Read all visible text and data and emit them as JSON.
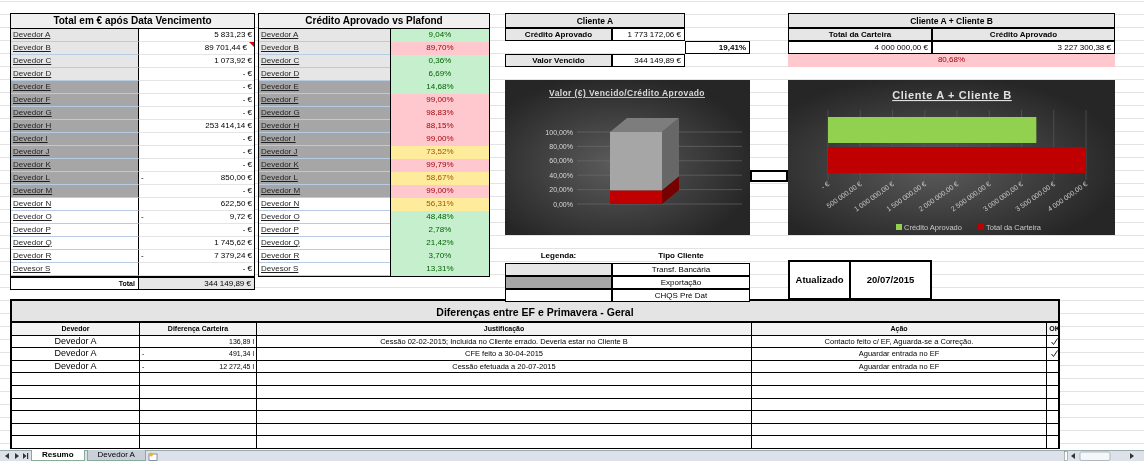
{
  "overdue_table": {
    "title": "Total em € após Data Vencimento",
    "rows": [
      {
        "name": "Devedor A",
        "color": "#e7e6e6",
        "value": "5 831,23 €",
        "commented": false
      },
      {
        "name": "Devedor B",
        "color": "#e7e6e6",
        "value": "89 701,44 €",
        "commented": true
      },
      {
        "name": "Devedor C",
        "color": "#e7e6e6",
        "value": "1 073,92 €",
        "commented": false
      },
      {
        "name": "Devedor D",
        "color": "#e7e6e6",
        "value": "- €",
        "commented": false
      },
      {
        "name": "Devedor E",
        "color": "#a6a6a6",
        "value": "- €",
        "commented": false
      },
      {
        "name": "Devedor F",
        "color": "#a6a6a6",
        "value": "- €",
        "commented": false
      },
      {
        "name": "Devedor G",
        "color": "#a6a6a6",
        "value": "- €",
        "commented": false
      },
      {
        "name": "Devedor H",
        "color": "#a6a6a6",
        "value": "253 414,14 €",
        "commented": false
      },
      {
        "name": "Devedor I",
        "color": "#a6a6a6",
        "value": "- €",
        "commented": false
      },
      {
        "name": "Devedor J",
        "color": "#a6a6a6",
        "value": "- €",
        "commented": false
      },
      {
        "name": "Devedor K",
        "color": "#a6a6a6",
        "value": "- €",
        "commented": false
      },
      {
        "name": "Devedor L",
        "color": "#a6a6a6",
        "sign": "-",
        "value": "850,00 €",
        "commented": false
      },
      {
        "name": "Devedor M",
        "color": "#a6a6a6",
        "value": "- €",
        "commented": false
      },
      {
        "name": "Devedor N",
        "color": "#ffffff",
        "value": "622,50 €",
        "commented": false
      },
      {
        "name": "Devedor O",
        "color": "#ffffff",
        "sign": "-",
        "value": "9,72 €",
        "commented": false
      },
      {
        "name": "Devedor P",
        "color": "#ffffff",
        "value": "- €",
        "commented": false
      },
      {
        "name": "Devedor Q",
        "color": "#ffffff",
        "value": "1 745,62 €",
        "commented": false
      },
      {
        "name": "Devedor R",
        "color": "#ffffff",
        "sign": "-",
        "value": "7 379,24 €",
        "commented": false
      },
      {
        "name": "Devesor S",
        "color": "#ffffff",
        "value": "- €",
        "commented": false
      }
    ],
    "total_label": "Total",
    "total_value": "344 149,89 €"
  },
  "credit_table": {
    "title": "Crédito Aprovado vs Plafond",
    "rows": [
      {
        "name": "Devedor A",
        "color": "#e7e6e6",
        "percent": {
          "value": "9,04%",
          "color": "#c6efce"
        }
      },
      {
        "name": "Devedor B",
        "color": "#e7e6e6",
        "percent": {
          "value": "89,70%",
          "color": "#ffc7ce"
        }
      },
      {
        "name": "Devedor C",
        "color": "#e7e6e6",
        "percent": {
          "value": "0,36%",
          "color": "#c6efce"
        }
      },
      {
        "name": "Devedor D",
        "color": "#e7e6e6",
        "percent": {
          "value": "6,69%",
          "color": "#c6efce"
        }
      },
      {
        "name": "Devedor E",
        "color": "#a6a6a6",
        "percent": {
          "value": "14,68%",
          "color": "#c6efce"
        }
      },
      {
        "name": "Devedor F",
        "color": "#a6a6a6",
        "percent": {
          "value": "99,00%",
          "color": "#ffc7ce"
        }
      },
      {
        "name": "Devedor G",
        "color": "#a6a6a6",
        "percent": {
          "value": "98,83%",
          "color": "#ffc7ce"
        }
      },
      {
        "name": "Devedor H",
        "color": "#a6a6a6",
        "percent": {
          "value": "88,15%",
          "color": "#ffc7ce"
        }
      },
      {
        "name": "Devedor I",
        "color": "#a6a6a6",
        "percent": {
          "value": "99,00%",
          "color": "#ffc7ce"
        }
      },
      {
        "name": "Devedor J",
        "color": "#a6a6a6",
        "percent": {
          "value": "73,52%",
          "color": "#ffeb9c"
        }
      },
      {
        "name": "Devedor K",
        "color": "#a6a6a6",
        "percent": {
          "value": "99,79%",
          "color": "#ffc7ce"
        }
      },
      {
        "name": "Devedor L",
        "color": "#a6a6a6",
        "percent": {
          "value": "58,67%",
          "color": "#ffeb9c"
        }
      },
      {
        "name": "Devedor M",
        "color": "#a6a6a6",
        "percent": {
          "value": "99,00%",
          "color": "#ffc7ce"
        }
      },
      {
        "name": "Devedor N",
        "color": "#ffffff",
        "percent": {
          "value": "56,31%",
          "color": "#ffeb9c"
        }
      },
      {
        "name": "Devedor O",
        "color": "#ffffff",
        "percent": {
          "value": "48,48%",
          "color": "#c6efce"
        }
      },
      {
        "name": "Devedor P",
        "color": "#ffffff",
        "percent": {
          "value": "2,78%",
          "color": "#c6efce"
        }
      },
      {
        "name": "Devedor Q",
        "color": "#ffffff",
        "percent": {
          "value": "21,42%",
          "color": "#c6efce"
        }
      },
      {
        "name": "Devedor R",
        "color": "#ffffff",
        "percent": {
          "value": "3,70%",
          "color": "#c6efce"
        }
      },
      {
        "name": "Devesor S",
        "color": "#ffffff",
        "percent": {
          "value": "13,31%",
          "color": "#c6efce"
        }
      }
    ]
  },
  "client_a": {
    "title": "Cliente A",
    "approved_label": "Crédito Aprovado",
    "approved_value": "1 773 172,06 €",
    "ratio": "19,41%",
    "overdue_label": "Valor Vencido",
    "overdue_value": "344 149,89 €",
    "chart_data": {
      "type": "bar",
      "title": "Valor (€) Vencido/Crédito Aprovado",
      "stacked": true,
      "grid": true,
      "series": [
        {
          "color": "#c00000",
          "values": [
            0.19
          ]
        },
        {
          "color": "#a6a6a6",
          "values": [
            0.81
          ]
        }
      ],
      "ylim": [
        0,
        1
      ],
      "yticks": [
        {
          "value": 0,
          "label": "0,00%"
        },
        {
          "value": 0.2,
          "label": "20,00%"
        },
        {
          "value": 0.4,
          "label": "40,00%"
        },
        {
          "value": 0.6,
          "label": "60,00%"
        },
        {
          "value": 0.8,
          "label": "80,00%"
        },
        {
          "value": 1,
          "label": "100,00%"
        }
      ]
    }
  },
  "legend": {
    "title": "Legenda:",
    "column_title": "Tipo Cliente",
    "items": [
      {
        "label": "Transf. Bancária",
        "color": "#e7e6e6"
      },
      {
        "label": "Exportação",
        "color": "#a6a6a6"
      },
      {
        "label": "CHQS Pré Dat",
        "color": "#ffffff"
      }
    ]
  },
  "clients_ab": {
    "title": "Cliente A + Cliente B",
    "columns": [
      "Total da Carteira",
      "Crédito Aprovado"
    ],
    "values": [
      "4 000 000,00 €",
      "3 227 300,38 €"
    ],
    "ratio": "80,68%",
    "chart_data": {
      "type": "bar",
      "orientation": "horizontal",
      "title": "Cliente A + Cliente B",
      "grid": true,
      "legend": "bottom",
      "series": [
        {
          "name": "Crédito Aprovado",
          "color": "#92d050",
          "values": [
            3230000
          ]
        },
        {
          "name": "Total da Carteira",
          "color": "#c00000",
          "values": [
            4000000
          ]
        }
      ],
      "xlim": [
        0,
        4000000
      ],
      "xticks": [
        {
          "value": 0,
          "label": "- €"
        },
        {
          "value": 500000,
          "label": "500 000,00 €"
        },
        {
          "value": 1000000,
          "label": "1 000 000,00 €"
        },
        {
          "value": 1500000,
          "label": "1 500 000,00 €"
        },
        {
          "value": 2000000,
          "label": "2 000 000,00 €"
        },
        {
          "value": 2500000,
          "label": "2 500 000,00 €"
        },
        {
          "value": 3000000,
          "label": "3 000 000,00 €"
        },
        {
          "value": 3500000,
          "label": "3 500 000,00 €"
        },
        {
          "value": 4000000,
          "label": "4 000 000,00 €"
        }
      ]
    }
  },
  "updated": {
    "label": "Atualizado",
    "date": "20/07/2015"
  },
  "differences": {
    "title": "Diferenças entre EF e Primavera - Geral",
    "columns": [
      "Devedor",
      "Diferença Carteira",
      "Justificação",
      "Ação",
      "OK"
    ],
    "rows": [
      {
        "debtor": "Devedor A",
        "difference": "136,89 l",
        "justification": "Cessão 02-02-2015; Incluída no Cliente errado. Deveria estar no Cliente B",
        "action": "Contacto feito c/ EF, Aguarda-se a Correção.",
        "ok": true
      },
      {
        "debtor": "Devedor A",
        "sign": "-",
        "difference": "491,34 l",
        "justification": "CFE feito a 30-04-2015",
        "action": "Aguardar entrada no EF",
        "ok": true
      },
      {
        "debtor": "Devedor A",
        "sign": "-",
        "difference": "12 272,45 l",
        "justification": "Cessão efetuada a 20-07-2015",
        "action": "Aguardar entrada no EF",
        "ok": false
      }
    ]
  },
  "sheet_tabs": [
    {
      "label": "Resumo",
      "selected": true
    },
    {
      "label": "Devedor A",
      "selected": false
    }
  ]
}
